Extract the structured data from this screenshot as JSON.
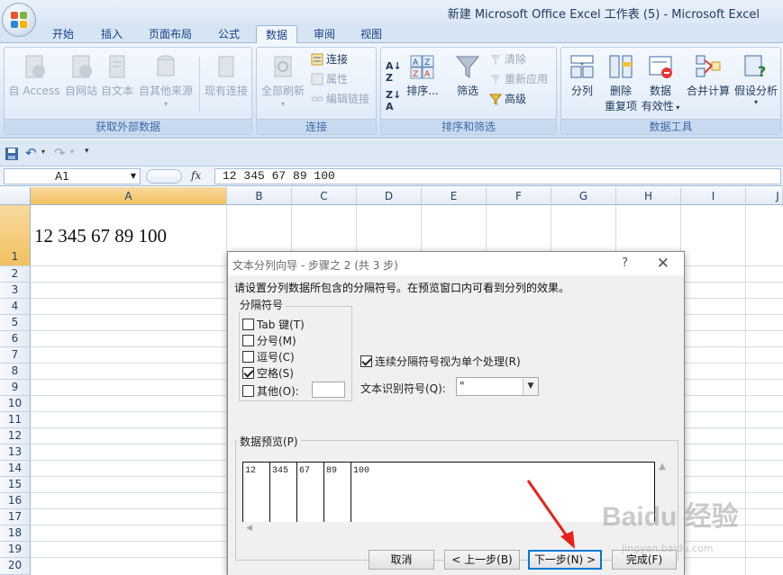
{
  "window": {
    "title": "新建 Microsoft Office Excel 工作表 (5) - Microsoft Excel"
  },
  "ribbon_tabs": [
    {
      "label": "开始",
      "active": false
    },
    {
      "label": "插入",
      "active": false
    },
    {
      "label": "页面布局",
      "active": false
    },
    {
      "label": "公式",
      "active": false
    },
    {
      "label": "数据",
      "active": true
    },
    {
      "label": "审阅",
      "active": false
    },
    {
      "label": "视图",
      "active": false
    }
  ],
  "groups": {
    "external": {
      "label": "获取外部数据",
      "buttons": [
        "自 Access",
        "自网站",
        "自文本",
        "自其他来源",
        "现有连接"
      ]
    },
    "connections": {
      "label": "连接",
      "refresh_all": "全部刷新",
      "small": [
        "连接",
        "属性",
        "编辑链接"
      ]
    },
    "sort_filter": {
      "label": "排序和筛选",
      "sort": "排序...",
      "filter": "筛选",
      "small": [
        "清除",
        "重新应用",
        "高级"
      ]
    },
    "tools": {
      "label": "数据工具",
      "buttons": [
        "分列",
        "删除\n重复项",
        "数据\n有效性",
        "合并计算",
        "假设分析"
      ],
      "btn2_line1": "删除",
      "btn2_line2": "重复项",
      "btn3_line1": "数据",
      "btn3_line2": "有效性"
    }
  },
  "formula_bar": {
    "cell_ref": "A1",
    "fx": "fx",
    "content": "12 345 67 89 100"
  },
  "sheet": {
    "columns": [
      "A",
      "B",
      "C",
      "D",
      "E",
      "F",
      "G",
      "H",
      "I",
      "J"
    ],
    "rows": [
      "1",
      "2",
      "3",
      "4",
      "5",
      "6",
      "7",
      "8",
      "9",
      "10",
      "11",
      "12",
      "13",
      "14",
      "15",
      "16",
      "17",
      "18",
      "19",
      "20"
    ],
    "cell_a1": "12  345  67  89  100"
  },
  "dialog": {
    "title": "文本分列向导 - 步骤之 2 (共 3 步)",
    "help": "?",
    "close": "✕",
    "description": "请设置分列数据所包含的分隔符号。在预览窗口内可看到分列的效果。",
    "delimiters_legend": "分隔符号",
    "delimiters": [
      {
        "label": "Tab 键(T)",
        "checked": false
      },
      {
        "label": "分号(M)",
        "checked": false
      },
      {
        "label": "逗号(C)",
        "checked": false
      },
      {
        "label": "空格(S)",
        "checked": true
      },
      {
        "label": "其他(O):",
        "checked": false
      }
    ],
    "consecutive_label": "连续分隔符号视为单个处理(R)",
    "consecutive_checked": true,
    "text_qualifier_label": "文本识别符号(Q):",
    "text_qualifier_value": "\"",
    "preview_legend": "数据预览(P)",
    "preview_cells": [
      "12",
      "345",
      "67",
      "89",
      "100"
    ],
    "buttons": {
      "cancel": "取消",
      "back": "< 上一步(B)",
      "next": "下一步(N) >",
      "finish": "完成(F)"
    }
  },
  "watermark": {
    "brand": "Baidu 经验",
    "url": "jingyan.baidu.com"
  }
}
